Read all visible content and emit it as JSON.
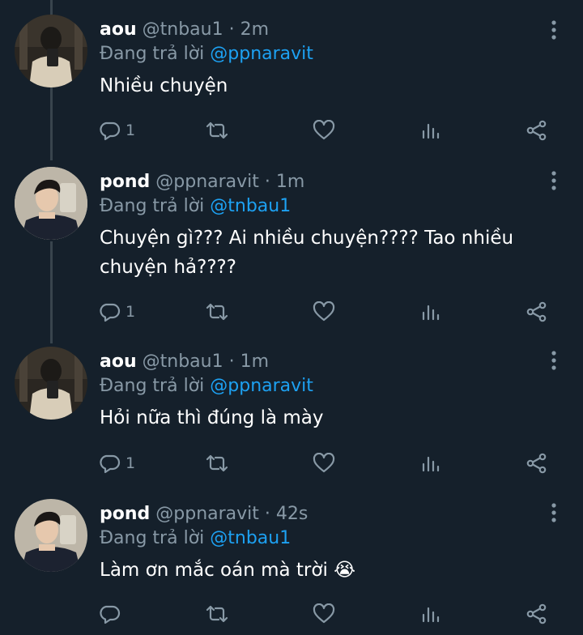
{
  "tweets": [
    {
      "name": "aou",
      "handle": "@tnbau1",
      "separator": "·",
      "time": "2m",
      "reply_prefix": "Đang trả lời",
      "reply_to": "@ppnaravit",
      "text": "Nhiều chuyện",
      "reply_count": "1",
      "avatar_icon": "avatar-aou"
    },
    {
      "name": "pond",
      "handle": "@ppnaravit",
      "separator": "·",
      "time": "1m",
      "reply_prefix": "Đang trả lời",
      "reply_to": "@tnbau1",
      "text": "Chuyện gì??? Ai nhiều chuyện???? Tao nhiều chuyện hả????",
      "reply_count": "1",
      "avatar_icon": "avatar-pond"
    },
    {
      "name": "aou",
      "handle": "@tnbau1",
      "separator": "·",
      "time": "1m",
      "reply_prefix": "Đang trả lời",
      "reply_to": "@ppnaravit",
      "text": "Hỏi nữa thì đúng là mày",
      "reply_count": "1",
      "avatar_icon": "avatar-aou"
    },
    {
      "name": "pond",
      "handle": "@ppnaravit",
      "separator": "·",
      "time": "42s",
      "reply_prefix": "Đang trả lời",
      "reply_to": "@tnbau1",
      "text": "Làm ơn mắc oán mà trời 😭",
      "reply_count": "",
      "avatar_icon": "avatar-pond"
    }
  ],
  "colors": {
    "background": "#15202b",
    "secondary_text": "#8899a6",
    "mention": "#1da1f2",
    "thread_line": "#38444d"
  },
  "icons": [
    "reply-icon",
    "retweet-icon",
    "like-icon",
    "views-icon",
    "share-icon",
    "more-options-icon"
  ]
}
